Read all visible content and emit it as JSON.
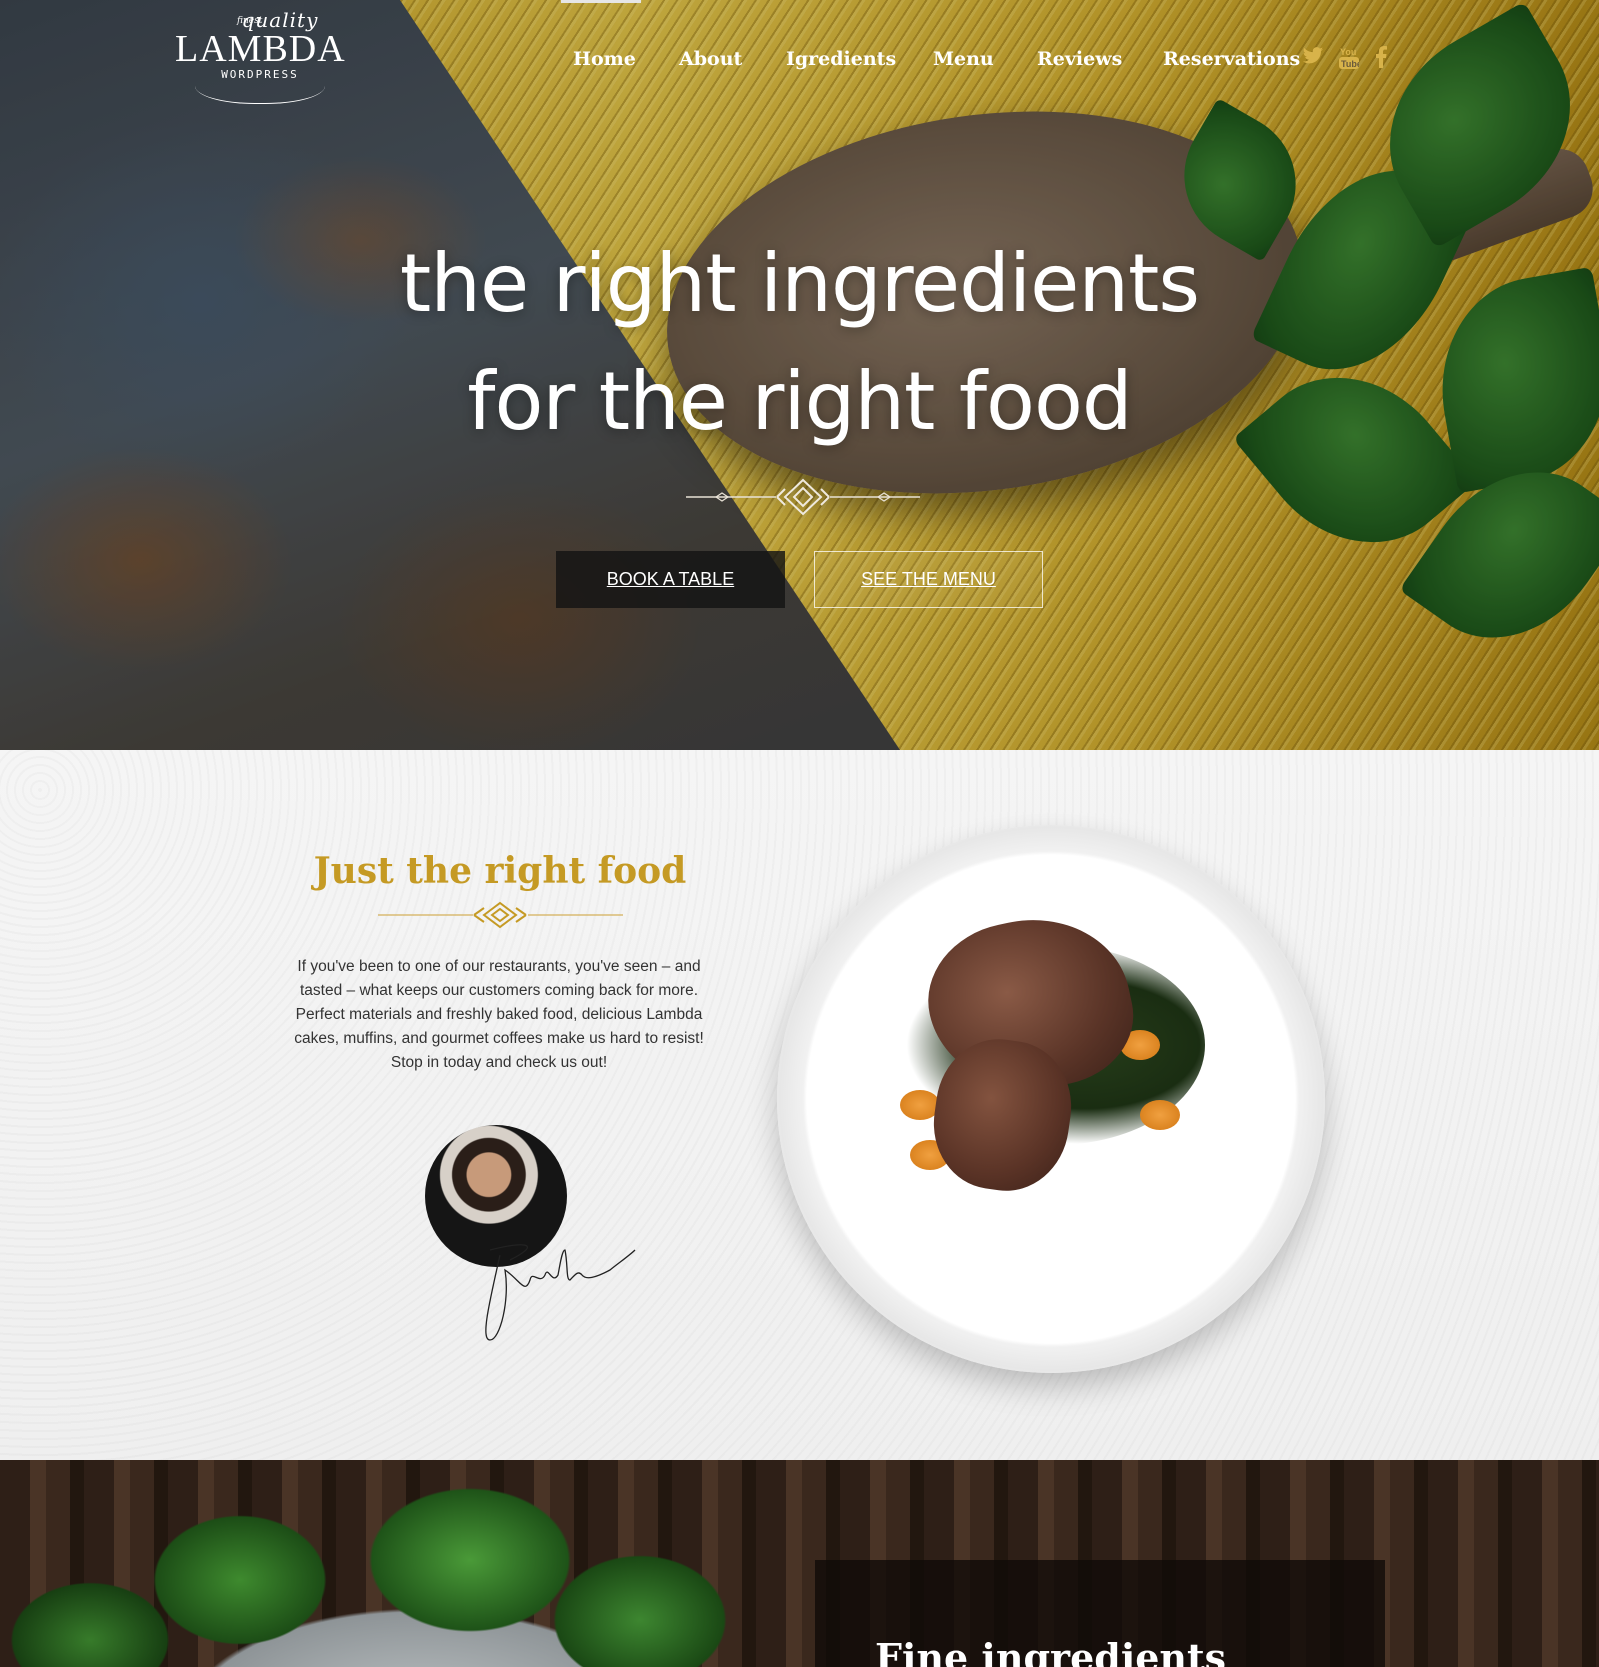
{
  "logo": {
    "finest": "finest",
    "quality": "quality",
    "name": "LAMBDA",
    "sub": "WORDPRESS"
  },
  "nav": {
    "items": [
      "Home",
      "About",
      "Igredients",
      "Menu",
      "Reviews",
      "Reservations"
    ]
  },
  "social": {
    "twitter": "twitter-icon",
    "youtube": "youtube-icon",
    "facebook": "facebook-icon"
  },
  "hero": {
    "line1": "the right ingredients",
    "line2": "for the right food",
    "book_label": "BOOK A TABLE",
    "menu_label": "SEE THE MENU"
  },
  "about": {
    "title": "Just the right food",
    "text": "If you've been to one of our restaurants, you've seen – and tasted – what keeps our customers coming back for more. Perfect materials and freshly baked food, delicious Lambda cakes,  muffins, and gourmet coffees make us hard to resist! Stop in today and check us out!"
  },
  "bottom": {
    "title": "Fine ingredients"
  },
  "colors": {
    "accent": "#c59a24",
    "social": "#d8b34a",
    "dark_button": "#141414"
  }
}
